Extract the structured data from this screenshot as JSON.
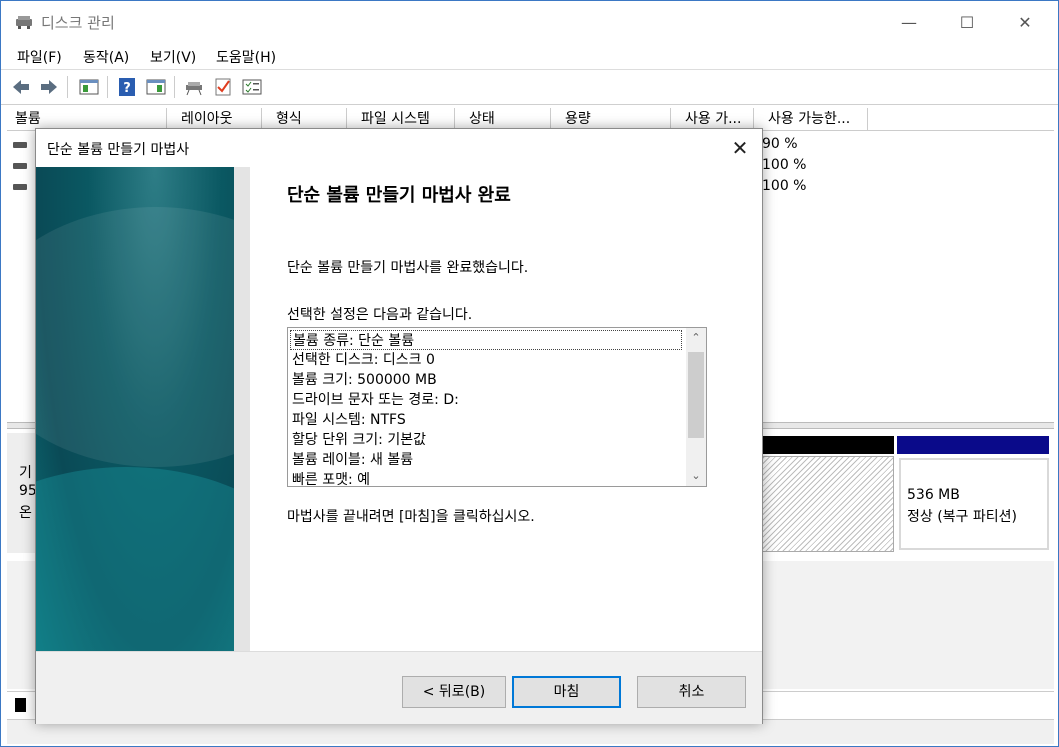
{
  "app": {
    "title": "디스크 관리"
  },
  "window_controls": {
    "minimize": "—",
    "maximize": "☐",
    "close": "✕"
  },
  "menu": [
    "파일(F)",
    "동작(A)",
    "보기(V)",
    "도움말(H)"
  ],
  "toolbar_icons": [
    "back-icon",
    "forward-icon",
    "console-tree-icon",
    "help-icon",
    "show-pane-icon",
    "connect-icon",
    "check-icon",
    "properties-icon"
  ],
  "columns": [
    "볼륨",
    "레이아웃",
    "형식",
    "파일 시스템",
    "상태",
    "용량",
    "사용 가...",
    "사용 가능한..."
  ],
  "volumes": [
    {
      "percent_free": "90 %"
    },
    {
      "percent_free": "100 %"
    },
    {
      "percent_free": "100 %"
    }
  ],
  "disk": {
    "label_fragments": [
      "기",
      "95",
      "온"
    ],
    "recovery_partition": {
      "size": "536 MB",
      "status": "정상 (복구 파티션)"
    }
  },
  "wizard": {
    "title": "단순 볼륨 만들기 마법사",
    "close": "✕",
    "heading": "단순 볼륨 만들기 마법사 완료",
    "message": "단순 볼륨 만들기 마법사를 완료했습니다.",
    "settings_label": "선택한 설정은 다음과 같습니다.",
    "settings": [
      "볼륨 종류: 단순 볼륨",
      "선택한 디스크: 디스크 0",
      "볼륨 크기: 500000 MB",
      "드라이브 문자 또는 경로: D:",
      "파일 시스템: NTFS",
      "할당 단위 크기: 기본값",
      "볼륨 레이블: 새 볼륨",
      "빠른 포맷: 예"
    ],
    "scroll_up": "⌃",
    "scroll_down": "⌄",
    "finish_hint": "마법사를 끝내려면 [마침]을 클릭하십시오.",
    "buttons": {
      "back": "< 뒤로(B)",
      "finish": "마침",
      "cancel": "취소"
    }
  }
}
